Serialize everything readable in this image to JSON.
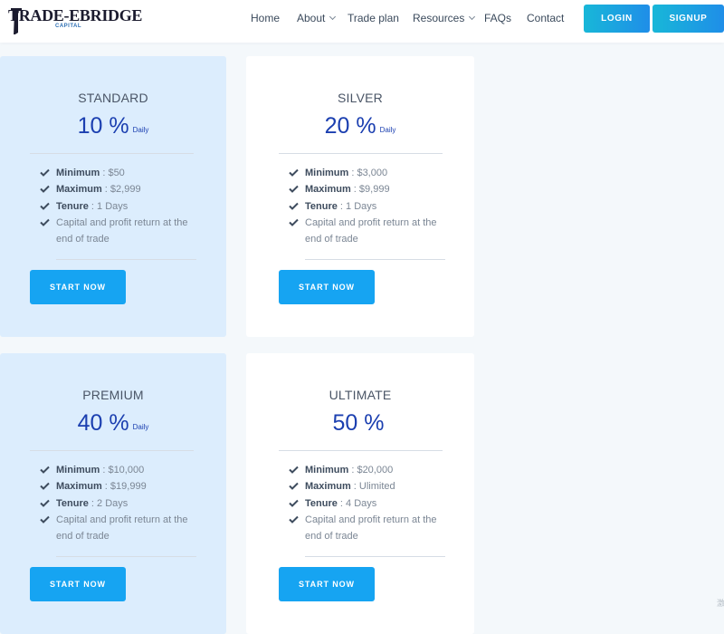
{
  "brand": {
    "name": "TRADE-EBRIDGE",
    "sub": "CAPITAL"
  },
  "nav": {
    "home": "Home",
    "about": "About",
    "trade_plan": "Trade plan",
    "resources": "Resources",
    "faqs": "FAQs",
    "contact": "Contact"
  },
  "auth": {
    "login": "LOGIN",
    "signup": "SIGNUP"
  },
  "plans": [
    {
      "name": "STANDARD",
      "rate": "10 %",
      "period": "Daily",
      "min_label": "Minimum",
      "min": " : $50",
      "max_label": "Maximum",
      "max": " : $2,999",
      "tenure_label": "Tenure",
      "tenure": " : 1 Days",
      "note": "Capital and profit return at the end of trade",
      "cta": "START NOW"
    },
    {
      "name": "SILVER",
      "rate": "20 %",
      "period": "Daily",
      "min_label": "Minimum",
      "min": " : $3,000",
      "max_label": "Maximum",
      "max": " : $9,999",
      "tenure_label": "Tenure",
      "tenure": " : 1 Days",
      "note": "Capital and profit return at the end of trade",
      "cta": "START NOW"
    },
    {
      "name": "PREMIUM",
      "rate": "40 %",
      "period": "Daily",
      "min_label": "Minimum",
      "min": " : $10,000",
      "max_label": "Maximum",
      "max": " : $19,999",
      "tenure_label": "Tenure",
      "tenure": " : 2 Days",
      "note": "Capital and profit return at the end of trade",
      "cta": "START NOW"
    },
    {
      "name": "ULTIMATE",
      "rate": "50 %",
      "period": "",
      "min_label": "Minimum",
      "min": " : $20,000",
      "max_label": "Maximum",
      "max": " : Ulimited",
      "tenure_label": "Tenure",
      "tenure": " : 4 Days",
      "note": "Capital and profit return at the end of trade",
      "cta": "START NOW"
    }
  ],
  "watermark": "激",
  "colors": {
    "accent": "#16a4f2",
    "rate": "#1b3fb0",
    "card_blue": "#dcedfd"
  }
}
